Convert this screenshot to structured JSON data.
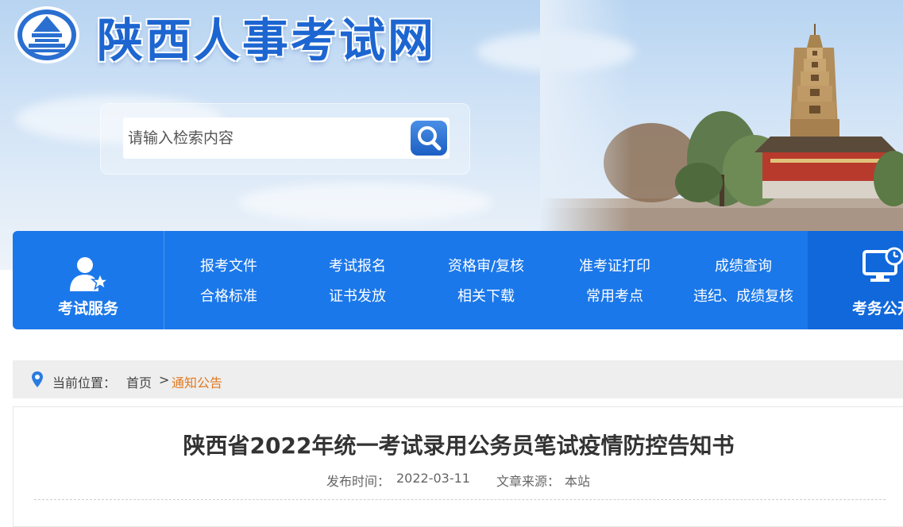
{
  "site": {
    "title": "陕西人事考试网"
  },
  "search": {
    "placeholder": "请输入检索内容"
  },
  "nav": {
    "left_label": "考试服务",
    "items_row1": [
      "报考文件",
      "考试报名",
      "资格审/复核",
      "准考证打印",
      "成绩查询"
    ],
    "items_row2": [
      "合格标准",
      "证书发放",
      "相关下载",
      "常用考点",
      "违纪、成绩复核"
    ],
    "right_label": "考务公开"
  },
  "breadcrumb": {
    "label": "当前位置：",
    "home": "首页",
    "separator": ">",
    "current": "通知公告"
  },
  "article": {
    "title": "陕西省2022年统一考试录用公务员笔试疫情防控告知书",
    "publish_label": "发布时间：",
    "publish_date": "2022-03-11",
    "source_label": "文章来源：",
    "source": "本站"
  },
  "colors": {
    "brand_blue": "#1b78ea",
    "title_blue": "#1d66d1",
    "breadcrumb_current": "#e2791f"
  },
  "icons": [
    "logo-emblem",
    "search-icon",
    "user-service-icon",
    "monitor-clock-icon",
    "location-pin-icon"
  ]
}
